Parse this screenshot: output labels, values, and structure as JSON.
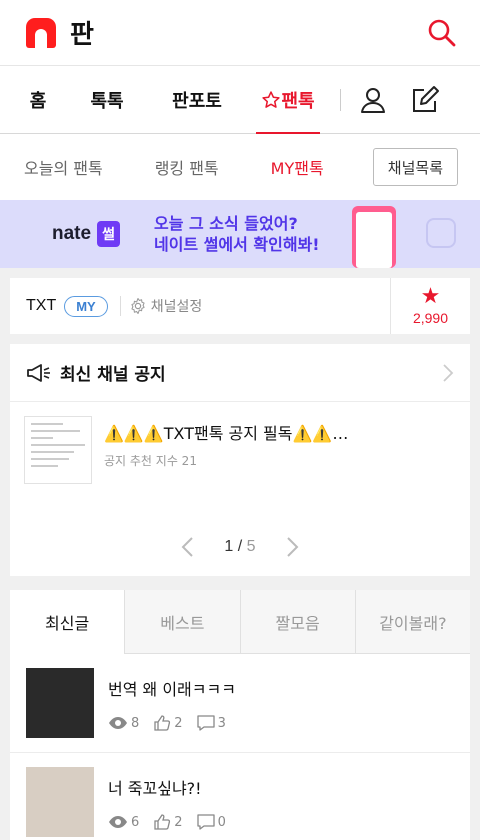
{
  "header": {
    "brand": "판",
    "icons": {
      "logo": "nate-n-logo",
      "search": "search-icon"
    }
  },
  "gnb": {
    "tabs": [
      {
        "label": "홈"
      },
      {
        "label": "톡톡"
      },
      {
        "label": "판포토"
      },
      {
        "label": "팬톡",
        "active": true,
        "icon": "star-outline-icon"
      }
    ],
    "icons": {
      "user": "user-icon",
      "write": "write-icon"
    }
  },
  "subnav": {
    "items": [
      {
        "label": "오늘의 팬톡"
      },
      {
        "label": "랭킹 팬톡"
      },
      {
        "label": "MY팬톡",
        "active": true
      }
    ],
    "channel_list_button": "채널목록"
  },
  "banner": {
    "brand": "nate",
    "badge": "썰",
    "line1": "오늘 그 소식 들었어?",
    "line2": "네이트 썰에서 확인해봐!"
  },
  "channel": {
    "name": "TXT",
    "my_badge": "MY",
    "settings_label": "채널설정",
    "star_count": "2,990"
  },
  "notice": {
    "title": "최신 채널 공지",
    "item": {
      "subject": "⚠️⚠️⚠️TXT팬톡 공지 필독⚠️⚠️…",
      "meta": "공지 추천 지수 21"
    },
    "pager": {
      "current": "1",
      "total": "5"
    }
  },
  "posts": {
    "tabs": [
      {
        "label": "최신글",
        "active": true
      },
      {
        "label": "베스트"
      },
      {
        "label": "짤모음"
      },
      {
        "label": "같이볼래?"
      }
    ],
    "items": [
      {
        "title": "번역 왜 이래ㅋㅋㅋ",
        "views": "8",
        "likes": "2",
        "comments": "3"
      },
      {
        "title": "너 죽꼬싶냐?!",
        "views": "6",
        "likes": "2",
        "comments": "0"
      }
    ]
  },
  "colors": {
    "accent": "#e8172d",
    "my_badge": "#3b80d2",
    "banner_bg": "#dcdcfb",
    "banner_text": "#5135e8"
  }
}
